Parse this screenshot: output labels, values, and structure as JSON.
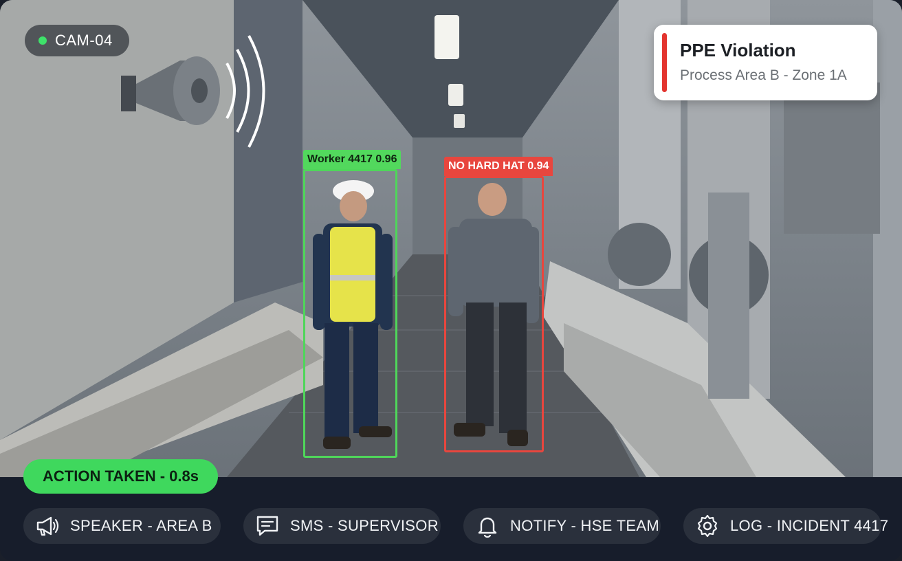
{
  "camera": {
    "label": "CAM-04",
    "status_color": "#3ee26a"
  },
  "alert": {
    "title": "PPE Violation",
    "location": "Process Area B - Zone 1A",
    "accent_color": "#e3342f"
  },
  "detections": [
    {
      "label": "Worker 4417  0.96",
      "color": "#52d85d"
    },
    {
      "label": "NO HARD HAT  0.94",
      "color": "#e8463e"
    }
  ],
  "action_status": {
    "label": "ACTION TAKEN - 0.8s",
    "color": "#3fd85d"
  },
  "actions": [
    {
      "label": "SPEAKER - AREA B",
      "icon": "megaphone-icon"
    },
    {
      "label": "SMS - SUPERVISOR",
      "icon": "message-icon"
    },
    {
      "label": "NOTIFY - HSE TEAM",
      "icon": "bell-icon"
    },
    {
      "label": "LOG - INCIDENT 4417",
      "icon": "gear-icon"
    }
  ]
}
